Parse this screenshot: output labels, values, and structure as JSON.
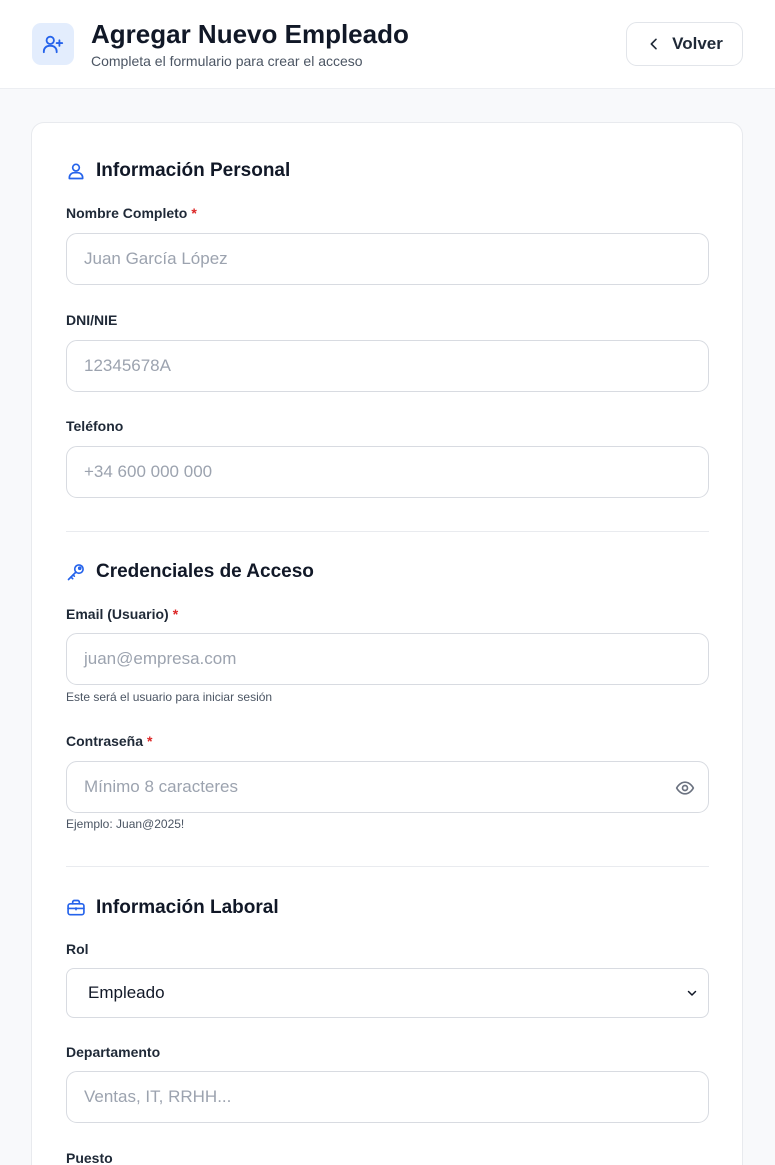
{
  "header": {
    "title": "Agregar Nuevo Empleado",
    "subtitle": "Completa el formulario para crear el acceso",
    "icon": "user-plus-icon",
    "back_label": "Volver"
  },
  "sections": {
    "personal": {
      "title": "Información Personal",
      "icon": "user-icon",
      "fields": {
        "nombre": {
          "label": "Nombre Completo",
          "required": "*",
          "placeholder": "Juan García López",
          "value": ""
        },
        "dni": {
          "label": "DNI/NIE",
          "placeholder": "12345678A",
          "value": ""
        },
        "telefono": {
          "label": "Teléfono",
          "placeholder": "+34 600 000 000",
          "value": ""
        }
      }
    },
    "credenciales": {
      "title": "Credenciales de Acceso",
      "icon": "key-icon",
      "fields": {
        "email": {
          "label": "Email (Usuario)",
          "required": "*",
          "placeholder": "juan@empresa.com",
          "value": "",
          "help": "Este será el usuario para iniciar sesión"
        },
        "password": {
          "label": "Contraseña",
          "required": "*",
          "placeholder": "Mínimo 8 caracteres",
          "value": "",
          "help": "Ejemplo: Juan@2025!",
          "toggle_icon": "eye-icon"
        }
      }
    },
    "laboral": {
      "title": "Información Laboral",
      "icon": "briefcase-icon",
      "fields": {
        "rol": {
          "label": "Rol",
          "selected": "Empleado"
        },
        "departamento": {
          "label": "Departamento",
          "placeholder": "Ventas, IT, RRHH...",
          "value": ""
        },
        "puesto": {
          "label": "Puesto"
        }
      }
    }
  },
  "colors": {
    "accent": "#2563eb",
    "required": "#dc2626",
    "icon_bg": "#e3edfd"
  }
}
